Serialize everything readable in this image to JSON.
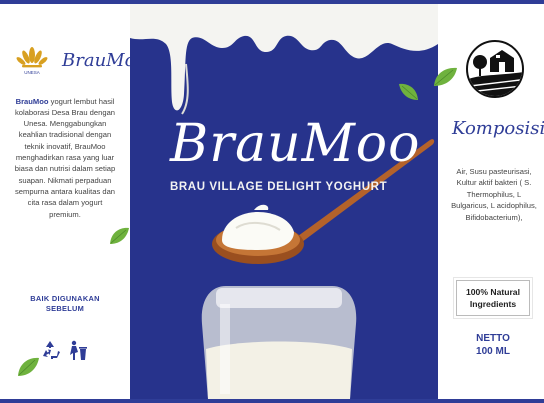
{
  "brand": {
    "name": "BrauMoo",
    "tagline": "BRAU VILLAGE DELIGHT YOGHURT",
    "emblem_caption": "UNESA"
  },
  "left": {
    "description_lead": "BrauMoo",
    "description": "yogurt lembut hasil kolaborasi Desa Brau dengan Unesa. Menggabungkan keahlian tradisional dengan teknik inovatif, BrauMoo menghadirkan rasa yang luar biasa dan nutrisi dalam setiap suapan. Nikmati perpaduan sempurna antara kualitas dan cita rasa dalam yogurt premium.",
    "best_before": "BAIK DIGUNAKAN SEBELUM",
    "icons": [
      "recycle-icon",
      "trash-bin-icon"
    ]
  },
  "right": {
    "komposisi_title": "Komposisi",
    "ingredients": "Air, Susu pasteurisasi, Kultur aktif bakteri ( S. Thermophilus, L Bulgaricus, L acidophilus, Bifidobacterium),",
    "natural_badge": "100% Natural Ingredients",
    "netto_label": "NETTO",
    "netto_value": "100 ML"
  },
  "colors": {
    "primary": "#2f3d97",
    "panel_bg": "#27338c",
    "leaf": "#6fb23e",
    "spoon": "#b4622a"
  }
}
